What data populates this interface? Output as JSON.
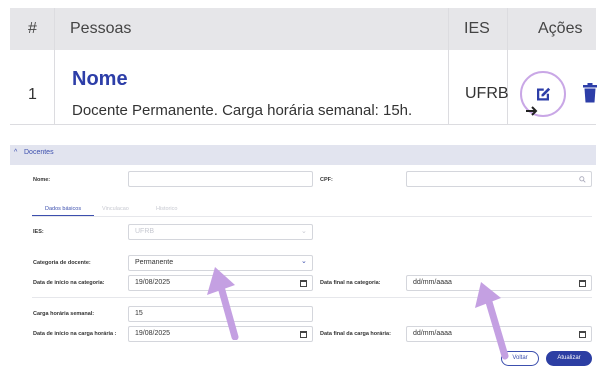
{
  "table": {
    "headers": [
      "#",
      "Pessoas",
      "IES",
      "Ações"
    ],
    "row": {
      "num": "1",
      "name": "Nome",
      "description": "Docente Permanente. Carga horária semanal: 15h.",
      "ies": "UFRB"
    }
  },
  "panel": {
    "title": "Docentes",
    "nome_label": "Nome:",
    "cpf_label": "CPF:",
    "tabs": [
      "Dados básicos",
      "Vinculacao",
      "Historico"
    ],
    "ies_label": "IES:",
    "ies_value": "UFRB",
    "categoria_label": "Categoria de docente:",
    "categoria_value": "Permanente",
    "data_inicio_cat_label": "Data de início na categoria:",
    "data_inicio_cat_value": "19/08/2025",
    "data_final_cat_label": "Data final na categoria:",
    "data_final_cat_value": "dd/mm/aaaa",
    "carga_label": "Carga horária semanal:",
    "carga_value": "15",
    "data_inicio_carga_label": "Data de início na carga horária :",
    "data_inicio_carga_value": "19/08/2025",
    "data_final_carga_label": "Data final da carga horária:",
    "data_final_carga_value": "dd/mm/aaaa",
    "voltar": "Voltar",
    "atualizar": "Atualizar"
  },
  "icons": [
    "edit-icon",
    "trash-icon",
    "search-icon",
    "chevron-up-icon",
    "chevron-down-icon",
    "calendar-icon",
    "pointer-cursor-icon"
  ],
  "colors": {
    "accent": "#2d3ea8",
    "highlight": "#c9a7e6",
    "header_bg": "#e6e6e9"
  }
}
